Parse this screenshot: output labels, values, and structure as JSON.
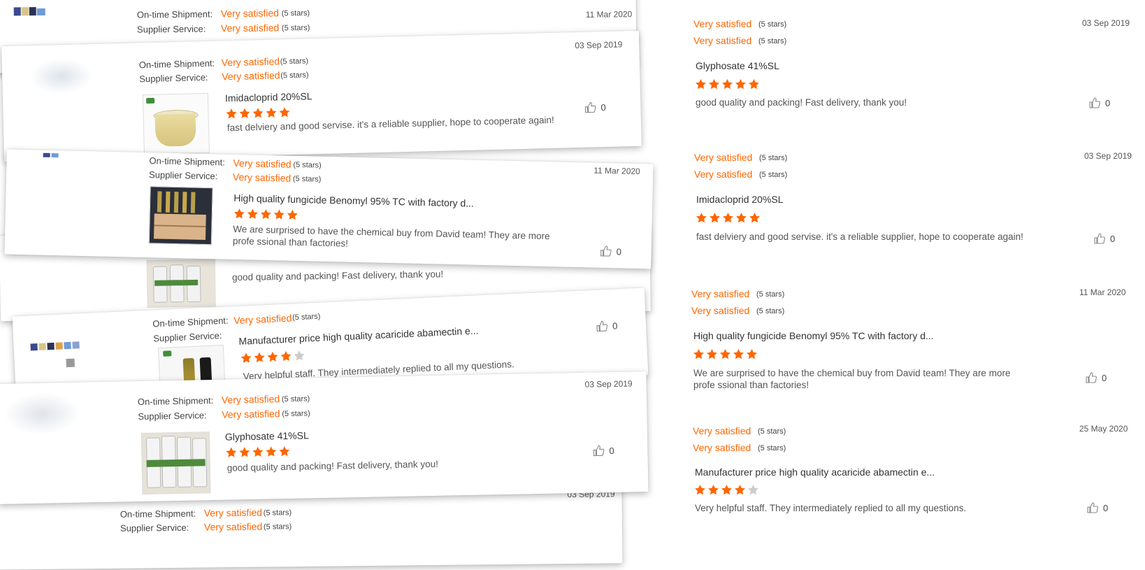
{
  "labels": {
    "shipment": "On-time Shipment:",
    "service": "Supplier Service:",
    "very_satisfied": "Very satisfied",
    "five_stars": "(5 stars)"
  },
  "colors": {
    "accent": "#ff6600",
    "star_empty": "#cccccc"
  },
  "icons": [
    "star-icon",
    "thumbs-up-icon",
    "product-thumbnail",
    "avatar"
  ],
  "collage": {
    "card_top": {
      "date": "11 Mar 2020"
    },
    "card_imidacloprid": {
      "date": "03 Sep 2019",
      "product": "Imidacloprid 20%SL",
      "rating": 5,
      "comment": "fast delviery and good servise. it's a reliable supplier, hope to cooperate again!",
      "likes": "0"
    },
    "card_glyphosate_back": {
      "comment": "good quality and packing! Fast delivery, thank you!"
    },
    "card_benomyl": {
      "date": "11 Mar 2020",
      "product": "High quality fungicide Benomyl 95% TC with factory d...",
      "rating": 5,
      "comment": "We are surprised to have the chemical buy from David team! They are more profe ssional than factories!",
      "likes": "0"
    },
    "card_abamectin": {
      "product": "Manufacturer price high quality acaricide abamectin e...",
      "rating": 4,
      "comment": "Very helpful staff. They intermediately replied to all my questions.",
      "likes": "0"
    },
    "card_glyphosate": {
      "date": "03 Sep 2019",
      "product": "Glyphosate 41%SL",
      "rating": 5,
      "comment": "good quality and packing! Fast delivery, thank you!",
      "likes": "0"
    },
    "card_bottom": {
      "date": "03 Sep 2019"
    }
  },
  "right_list": [
    {
      "date": "03 Sep 2019",
      "product": "Glyphosate 41%SL",
      "rating": 5,
      "comment": "good quality and packing! Fast delivery, thank you!",
      "likes": "0"
    },
    {
      "date": "03 Sep 2019",
      "product": "Imidacloprid 20%SL",
      "rating": 5,
      "comment": "fast delviery and good servise. it's a reliable supplier, hope to cooperate again!",
      "likes": "0"
    },
    {
      "date": "11 Mar 2020",
      "product": "High quality fungicide Benomyl 95% TC with factory d...",
      "rating": 5,
      "comment": "We are surprised to have the chemical buy from David team! They are more profe ssional than factories!",
      "likes": "0"
    },
    {
      "date": "25 May 2020",
      "product": "Manufacturer price high quality acaricide abamectin e...",
      "rating": 4,
      "comment": "Very helpful staff. They intermediately replied to all my questions.",
      "likes": "0"
    }
  ]
}
